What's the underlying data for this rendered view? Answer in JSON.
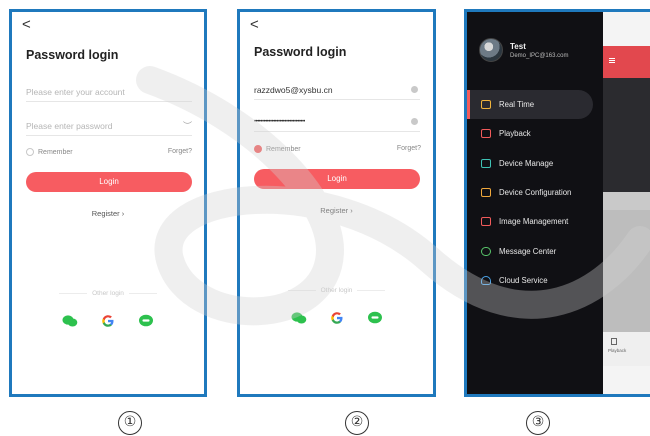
{
  "panel1": {
    "back": "<",
    "title": "Password login",
    "account_placeholder": "Please enter your account",
    "password_placeholder": "Please enter password",
    "remember": "Remember",
    "forgot": "Forget?",
    "login": "Login",
    "register": "Register ›",
    "other_login": "Other login",
    "social": [
      "wechat-icon",
      "google-icon",
      "line-icon"
    ]
  },
  "panel2": {
    "back": "<",
    "title": "Password login",
    "account_value": "razzdwo5@xysbu.cn",
    "password_value": "••••••••••••••••••••••••••••••••",
    "remember": "Remember",
    "forgot": "Forget?",
    "login": "Login",
    "register": "Register ›",
    "other_login": "Other login"
  },
  "panel3": {
    "user": {
      "name": "Test",
      "email": "Demo_IPC@163.com"
    },
    "menu": [
      {
        "label": "Real Time",
        "icon": "realtime-icon",
        "color": "#f0b43c"
      },
      {
        "label": "Playback",
        "icon": "playback-icon",
        "color": "#f25b5b"
      },
      {
        "label": "Device Manage",
        "icon": "device-manage-icon",
        "color": "#3fc2b5"
      },
      {
        "label": "Device Configuration",
        "icon": "device-config-icon",
        "color": "#f0a83c"
      },
      {
        "label": "Image Management",
        "icon": "image-icon",
        "color": "#f25b5b"
      },
      {
        "label": "Message Center",
        "icon": "message-icon",
        "color": "#58c46a"
      },
      {
        "label": "Cloud Service",
        "icon": "cloud-icon",
        "color": "#4aa3e8"
      }
    ],
    "bottom_tab": "Playback"
  },
  "labels": [
    "①",
    "②",
    "③"
  ],
  "colors": {
    "border": "#1f79bd",
    "accent": "#f75c61",
    "dark_bg": "#101014"
  }
}
